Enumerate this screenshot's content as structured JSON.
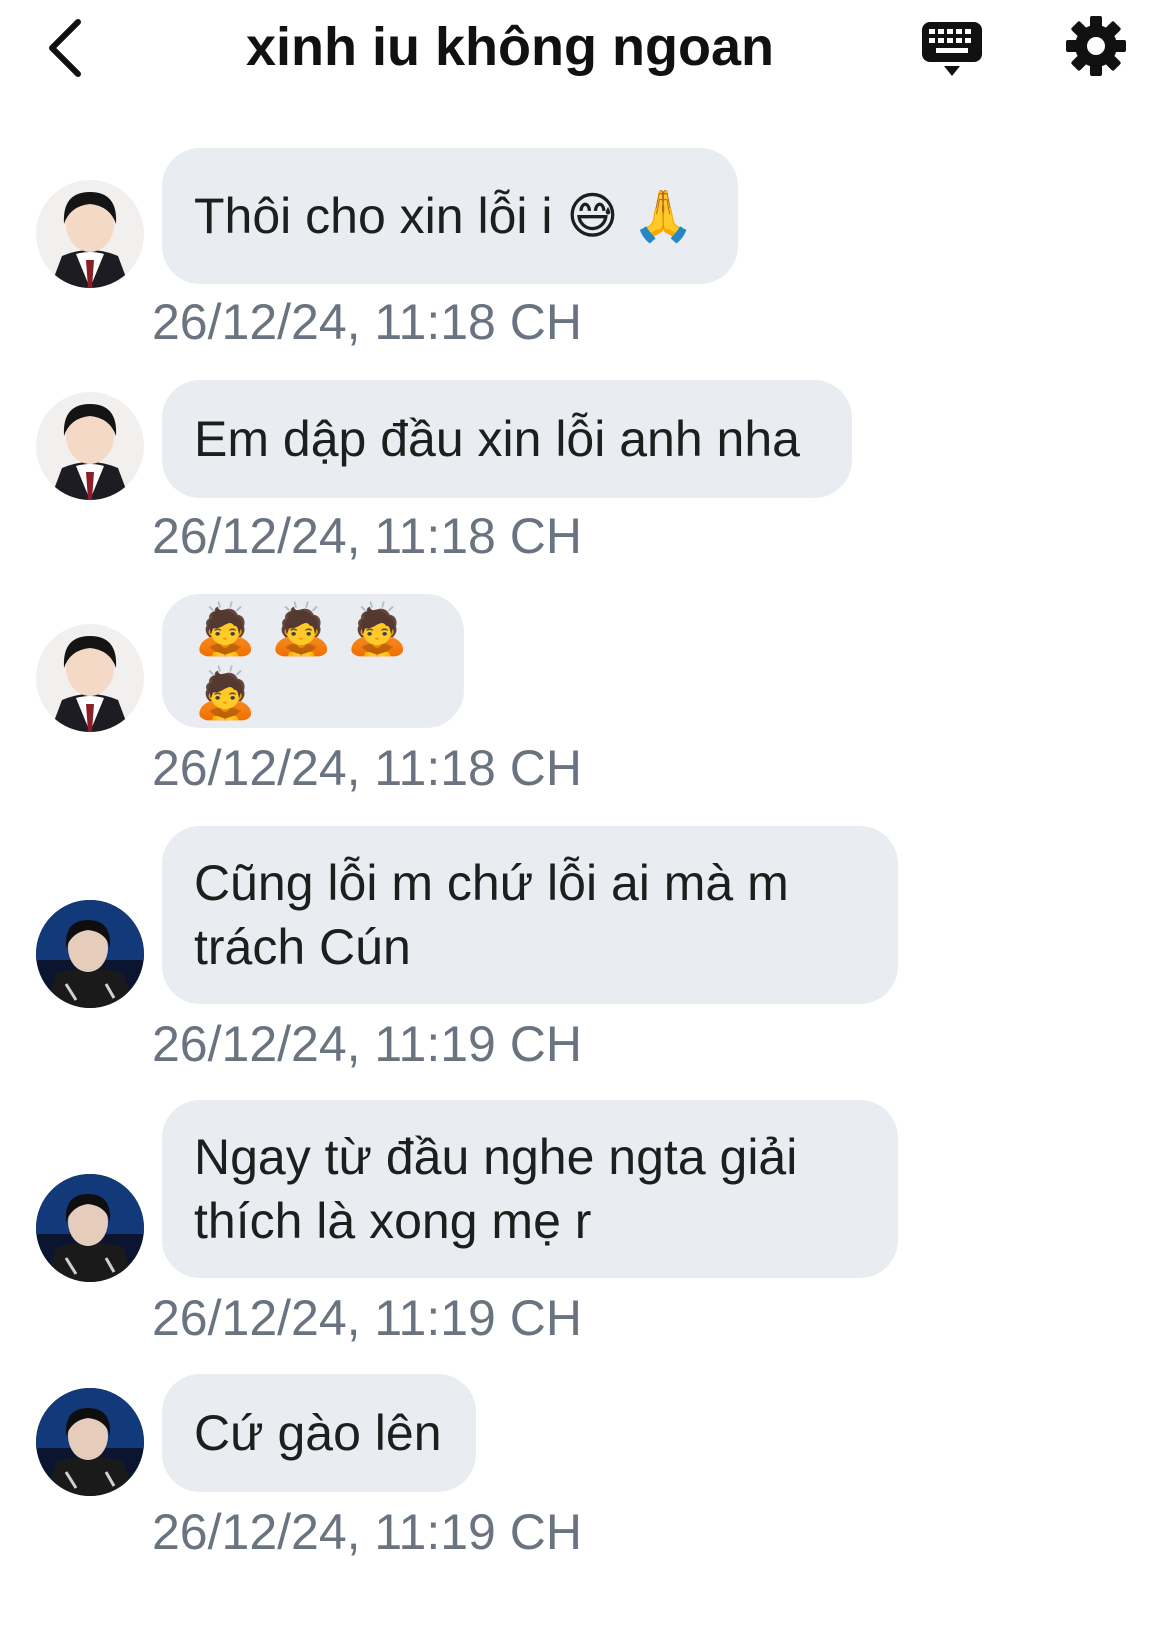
{
  "header": {
    "title": "xinh iu không ngoan",
    "back_icon": "chevron-left-icon",
    "keyboard_icon": "keyboard-icon",
    "settings_icon": "gear-icon"
  },
  "colors": {
    "bubble": "#e9edf2",
    "timestamp": "#6a7480",
    "text": "#1e1e1e"
  },
  "messages": [
    {
      "sender": "boy-white-uniform",
      "text": "Thôi cho xin lỗi i 😅 🙏",
      "time": "26/12/24, 11:18 CH"
    },
    {
      "sender": "boy-white-uniform",
      "text": "Em dập đầu xin lỗi anh nha",
      "time": "26/12/24, 11:18 CH"
    },
    {
      "sender": "boy-white-uniform",
      "text": "🙇 🙇 🙇 🙇",
      "time": "26/12/24, 11:18 CH"
    },
    {
      "sender": "boy-dark-jacket",
      "text": "Cũng lỗi m chứ lỗi ai mà m trách Cún",
      "time": "26/12/24, 11:19 CH"
    },
    {
      "sender": "boy-dark-jacket",
      "text": "Ngay từ đầu nghe ngta giải thích là xong mẹ r",
      "time": "26/12/24, 11:19 CH"
    },
    {
      "sender": "boy-dark-jacket",
      "text": "Cứ gào lên",
      "time": "26/12/24, 11:19 CH"
    }
  ]
}
